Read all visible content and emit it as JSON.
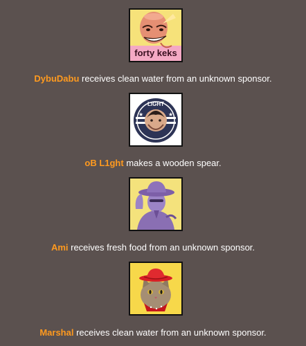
{
  "events": [
    {
      "tribute": "DybuDabu",
      "action": " receives clean water from an unknown sponsor.",
      "avatar_icon": "bald-man-forty-keks-avatar",
      "avatar_text": "forty keks"
    },
    {
      "tribute": "oB L1ght",
      "action": " makes a wooden spear.",
      "avatar_icon": "light-emblem-avatar",
      "avatar_text": "LIGHT"
    },
    {
      "tribute": "Ami",
      "action": " receives fresh food from an unknown sponsor.",
      "avatar_icon": "purple-cowboy-avatar"
    },
    {
      "tribute": "Marshal",
      "action": " receives clean water from an unknown sponsor.",
      "avatar_icon": "cat-with-red-hat-avatar"
    }
  ],
  "colors": {
    "background": "#5b514f",
    "tribute_name": "#ff9a1f",
    "text": "#ffffff"
  }
}
